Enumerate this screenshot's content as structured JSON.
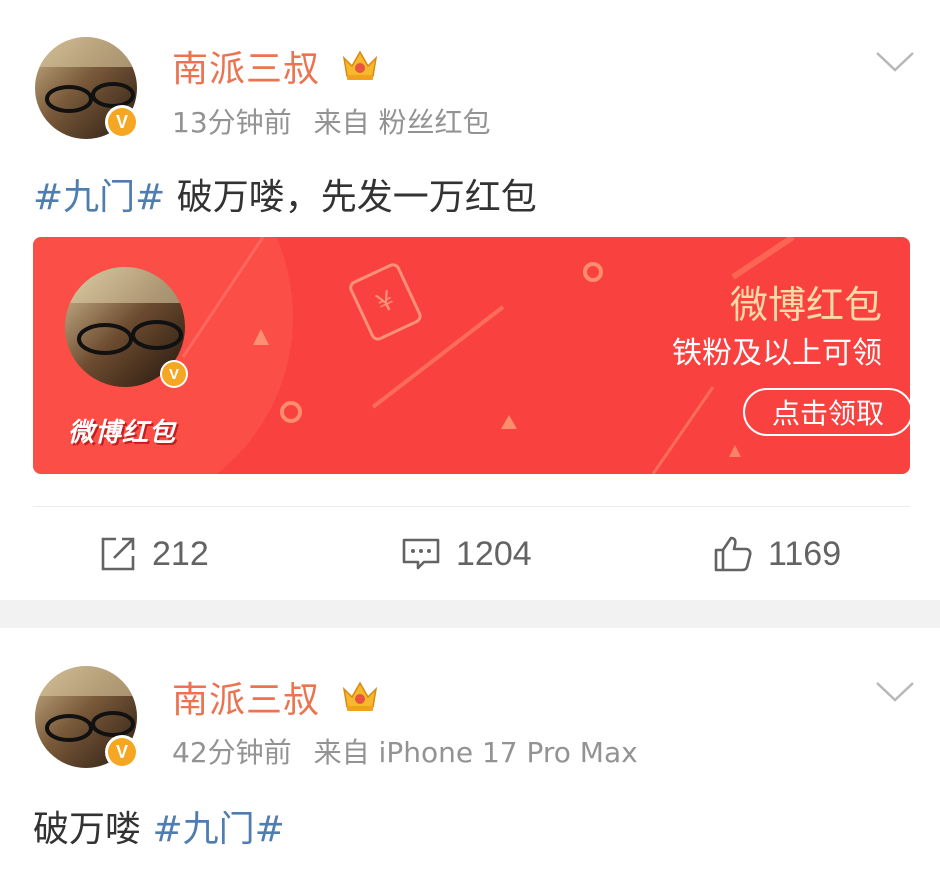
{
  "posts": [
    {
      "user": {
        "name": "南派三叔",
        "verified_badge": "V"
      },
      "time": "13分钟前",
      "source": "来自 粉丝红包",
      "topic": "#九门#",
      "text": "破万喽，先发一万红包",
      "card": {
        "title": "微博红包",
        "subtitle": "铁粉及以上可领",
        "button": "点击领取",
        "brand": "微博红包"
      },
      "actions": {
        "repost": "212",
        "comment": "1204",
        "like": "1169"
      }
    },
    {
      "user": {
        "name": "南派三叔",
        "verified_badge": "V"
      },
      "time": "42分钟前",
      "source": "来自 iPhone 17 Pro Max",
      "text": "破万喽",
      "topic": "#九门#"
    }
  ],
  "colors": {
    "name": "#eb7350",
    "topic": "#507daf",
    "card_bg": "#f9413f",
    "card_title": "#ffd9a6"
  },
  "icons": [
    "chevron-down-icon",
    "crown-icon",
    "repost-icon",
    "comment-icon",
    "like-icon",
    "red-packet-icon"
  ]
}
